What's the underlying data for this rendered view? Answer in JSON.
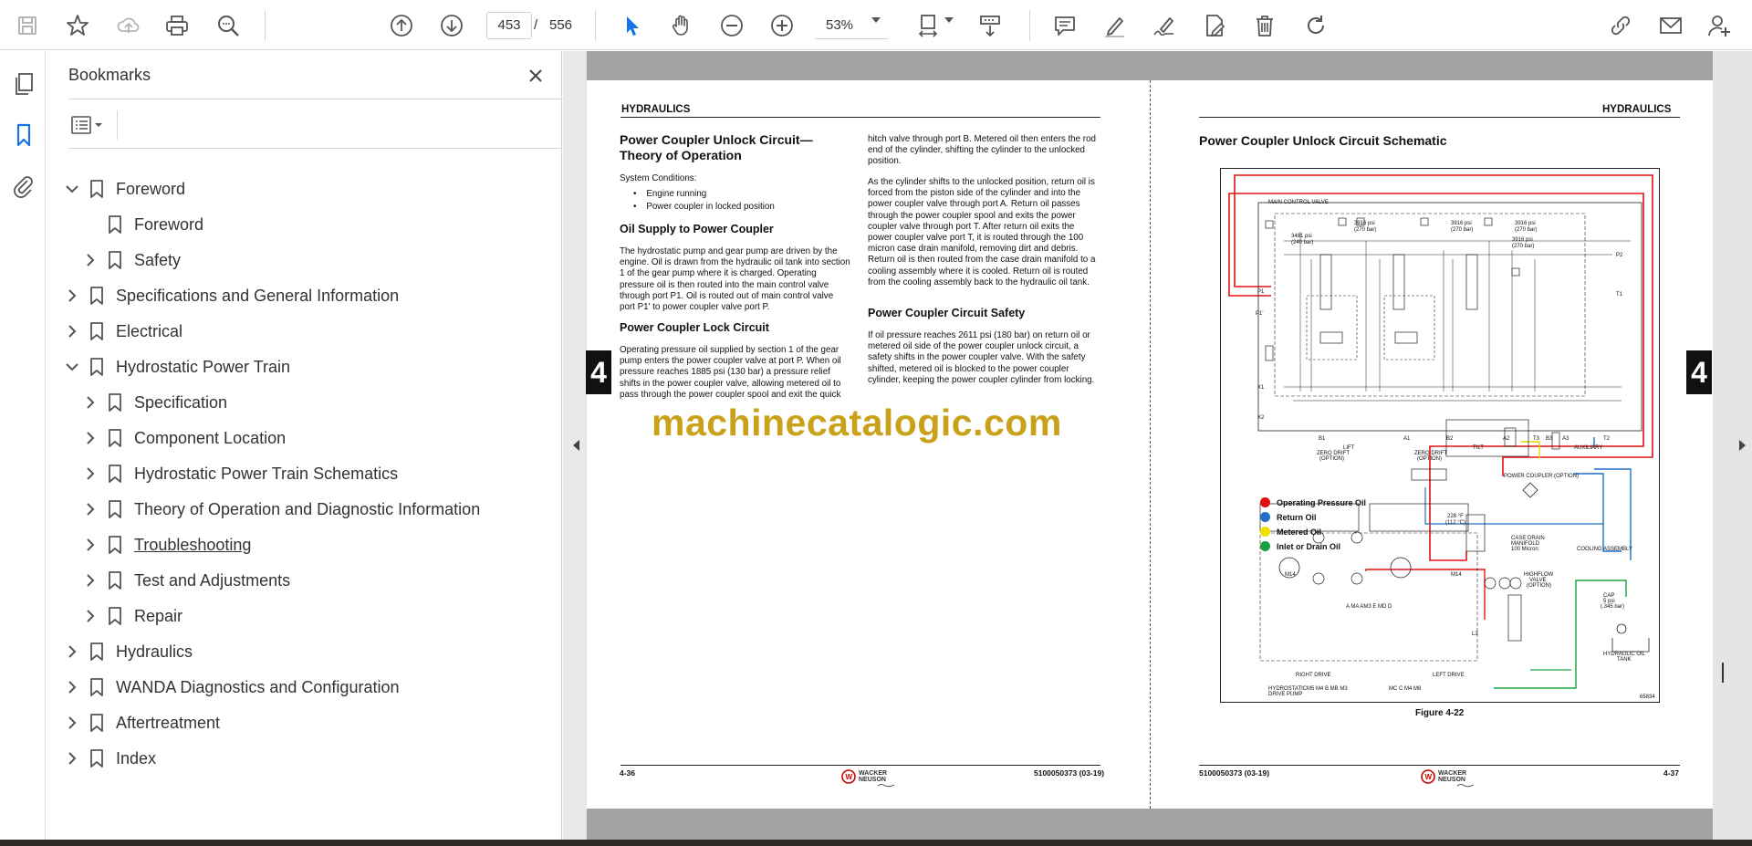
{
  "toolbar": {
    "current_page": "453",
    "page_separator": "/",
    "total_pages": "556",
    "zoom": "53%"
  },
  "bookmarks_panel": {
    "title": "Bookmarks",
    "items": [
      {
        "label": "Foreword",
        "state": "expanded",
        "level": 0
      },
      {
        "label": "Foreword",
        "state": "leaf",
        "level": 1
      },
      {
        "label": "Safety",
        "state": "collapsed",
        "level": 1
      },
      {
        "label": "Specifications and General Information",
        "state": "collapsed",
        "level": 0
      },
      {
        "label": "Electrical",
        "state": "collapsed",
        "level": 0
      },
      {
        "label": "Hydrostatic Power Train",
        "state": "expanded",
        "level": 0
      },
      {
        "label": "Specification",
        "state": "collapsed",
        "level": 1
      },
      {
        "label": "Component Location",
        "state": "collapsed",
        "level": 1
      },
      {
        "label": "Hydrostatic Power Train Schematics",
        "state": "collapsed",
        "level": 1
      },
      {
        "label": "Theory of Operation and Diagnostic Information",
        "state": "collapsed",
        "level": 1
      },
      {
        "label": "Troubleshooting",
        "state": "collapsed",
        "level": 1,
        "hovered": true
      },
      {
        "label": "Test and Adjustments",
        "state": "collapsed",
        "level": 1
      },
      {
        "label": "Repair",
        "state": "collapsed",
        "level": 1
      },
      {
        "label": "Hydraulics",
        "state": "collapsed",
        "level": 0
      },
      {
        "label": "WANDA Diagnostics and Configuration",
        "state": "collapsed",
        "level": 0
      },
      {
        "label": "Aftertreatment",
        "state": "collapsed",
        "level": 0
      },
      {
        "label": "Index",
        "state": "collapsed",
        "level": 0
      }
    ]
  },
  "left_page": {
    "header": "HYDRAULICS",
    "title": "Power Coupler Unlock Circuit— Theory of Operation",
    "system_conditions_label": "System Conditions:",
    "bullets": [
      "Engine running",
      "Power coupler in locked position"
    ],
    "section1_title": "Oil Supply to Power Coupler",
    "section1_text": "The hydrostatic pump and gear pump are driven by the engine. Oil is drawn from the hydraulic oil tank into section 1 of the gear pump where it is charged. Operating pressure oil is then routed into the main control valve through port P1. Oil is routed out of main control valve port P1' to power coupler valve port P.",
    "section2_title": "Power Coupler Lock Circuit",
    "section2_text": "Operating pressure oil supplied by section 1 of the gear pump enters the power coupler valve at port P. When oil pressure reaches 1885 psi (130 bar) a pressure relief shifts in the power coupler valve, allowing metered oil to pass through the power coupler spool and exit the quick",
    "col2_text1": "hitch valve through port B. Metered oil then enters the rod end of the cylinder, shifting the cylinder to the unlocked position.",
    "col2_text2": "As the cylinder shifts to the unlocked position, return oil is forced from the piston side of the cylinder and into the power coupler valve through port A. Return oil passes through the power coupler spool and exits the power coupler valve through port T. After return oil exits the power coupler valve port T, it is routed through the 100 micron case drain manifold, removing dirt and debris. Return oil is then routed from the case drain manifold to a cooling assembly where it is cooled. Return oil is routed from the cooling assembly back to the hydraulic oil tank.",
    "section3_title": "Power Coupler Circuit Safety",
    "section3_text": "If oil pressure reaches 2611 psi (180 bar) on return oil or metered oil side of the power coupler unlock circuit, a safety shifts in the power coupler valve. With the safety shifted, metered oil is blocked to the power coupler cylinder, keeping the power coupler cylinder from locking.",
    "tab": "4",
    "footer_left": "4-36",
    "footer_right": "5100050373 (03-19)"
  },
  "right_page": {
    "header": "HYDRAULICS",
    "title": "Power Coupler Unlock Circuit Schematic",
    "figure_caption": "Figure 4-22",
    "tab": "4",
    "footer_left": "5100050373 (03-19)",
    "footer_right": "4-37",
    "legend": [
      {
        "label": "Operating Pressure Oil",
        "color": "#e01010"
      },
      {
        "label": "Return Oil",
        "color": "#1f6fc4"
      },
      {
        "label": "Metered Oil",
        "color": "#f0e000"
      },
      {
        "label": "Inlet or Drain Oil",
        "color": "#1aa040"
      }
    ],
    "schematic_labels": {
      "main_control_valve": "MAIN CONTROL VALVE",
      "p1": "P1",
      "p1_prime": "P1'",
      "x1": "X1",
      "x2": "X2",
      "p2": "P2",
      "t1": "T1",
      "psi_3481": "3481 psi",
      "bar_240": "(240 bar)",
      "psi_3916_a": "3916 psi",
      "bar_270_a": "(270 bar)",
      "psi_3916_b": "3916 psi",
      "bar_270_b": "(270 bar)",
      "psi_3916_c": "3916 psi",
      "bar_270_c": "(270 bar)",
      "psi_3916_d": "3916 psi",
      "bar_270_d": "(270 bar)",
      "b1": "B1",
      "lift": "LIFT",
      "a1": "A1",
      "b2": "B2",
      "tilt": "TILT",
      "a2": "A2",
      "t3": "T3",
      "b3": "B3",
      "a3": "A3",
      "auxiliary": "AUXILIARY",
      "t2": "T2",
      "zero_drift_1": "ZERO DRIFT",
      "option_1": "(OPTION)",
      "zero_drift_2": "ZERO DRIFT",
      "option_2": "(OPTION)",
      "power_coupler": "POWER COUPLER (OPTION)",
      "temp": "228 °F",
      "temp_c": "(112 °C)",
      "case_drain": "CASE DRAIN",
      "manifold": "MANIFOLD",
      "micron": "100 Micron",
      "cooling": "COOLING ASSEMBLY",
      "m14_a": "M14",
      "m14_b": "M14",
      "highflow": "HIGHFLOW",
      "valve": "VALVE",
      "hf_option": "(OPTION)",
      "cap": "CAP",
      "cap_psi": "5 psi",
      "cap_bar": "(.345 bar)",
      "hyd_oil": "HYDRAULIC OIL",
      "tank": "TANK",
      "hydrostatic": "HYDROSTATIC",
      "drive_pump": "DRIVE PUMP",
      "right_drive": "RIGHT DRIVE",
      "left_drive": "LEFT DRIVE",
      "ports_top": "A  MA  AM3  E  MD  D",
      "ports_bottom_1": "M5    M4    B  MB  M3",
      "ports_bottom_2": "MC  C    M4    M8",
      "l3": "L3",
      "fig_no": "65834"
    }
  },
  "watermark": "machinecatalogic.com"
}
